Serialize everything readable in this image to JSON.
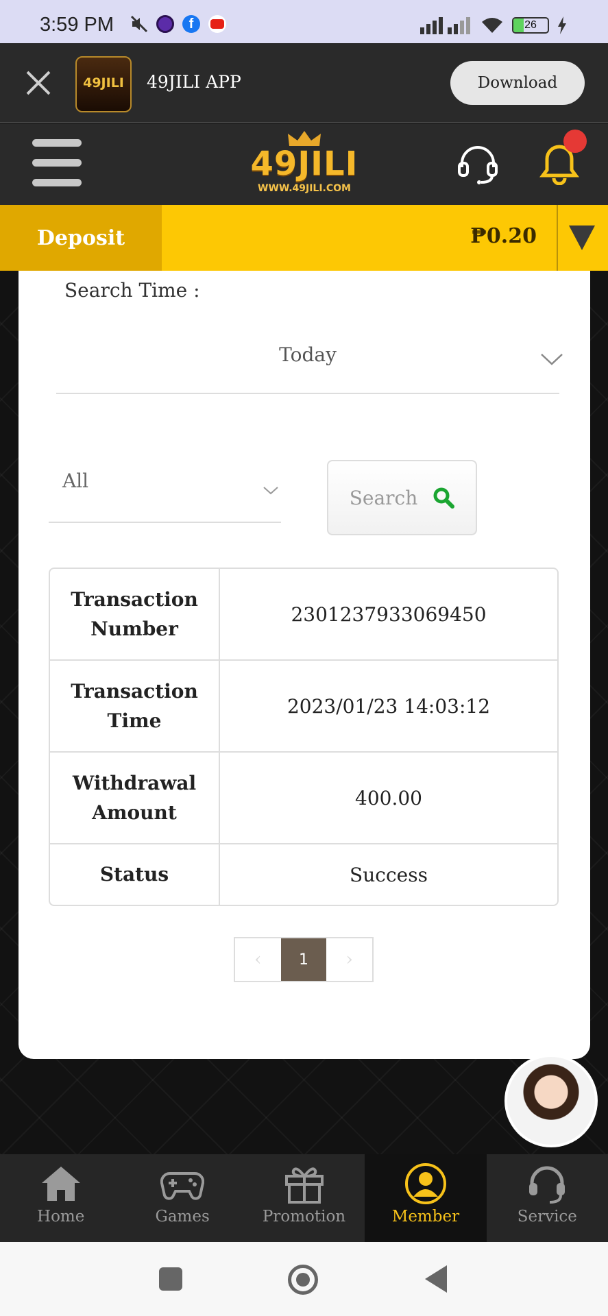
{
  "status_bar": {
    "time": "3:59 PM",
    "battery": "26",
    "icons": [
      "mute-icon",
      "app-icon",
      "facebook-icon",
      "youtube-icon",
      "signal-icon",
      "wifi-icon",
      "battery-icon",
      "charging-icon"
    ]
  },
  "app_banner": {
    "logo_text": "49JILI",
    "app_name": "49JILI APP",
    "download_label": "Download"
  },
  "header": {
    "brand": "49JILI",
    "brand_url": "WWW.49JILI.COM",
    "icons": [
      "menu-icon",
      "support-headset-icon",
      "bell-icon"
    ]
  },
  "balance_bar": {
    "deposit_label": "Deposit",
    "balance": "₱0.20"
  },
  "filters": {
    "search_time_label": "Search Time :",
    "time_value": "Today",
    "type_value": "All",
    "search_label": "Search"
  },
  "transaction": {
    "rows": [
      {
        "label": "Transaction Number",
        "value": "2301237933069450"
      },
      {
        "label": "Transaction Time",
        "value": "2023/01/23 14:03:12"
      },
      {
        "label": "Withdrawal Amount",
        "value": "400.00"
      },
      {
        "label": "Status",
        "value": "Success"
      }
    ]
  },
  "pagination": {
    "prev": "‹",
    "current": "1",
    "next": "›"
  },
  "bottom_nav": {
    "items": [
      {
        "label": "Home",
        "icon": "home-icon"
      },
      {
        "label": "Games",
        "icon": "gamepad-icon"
      },
      {
        "label": "Promotion",
        "icon": "gift-icon"
      },
      {
        "label": "Member",
        "icon": "member-icon"
      },
      {
        "label": "Service",
        "icon": "headset-icon"
      }
    ],
    "active": "Member"
  },
  "colors": {
    "accent_yellow": "#fdc804",
    "deposit_gold": "#e0a800",
    "header_dark": "#2a2a2a",
    "active_nav": "#f7c21a",
    "search_icon_green": "#1aa531",
    "notification_red": "#e53935"
  }
}
